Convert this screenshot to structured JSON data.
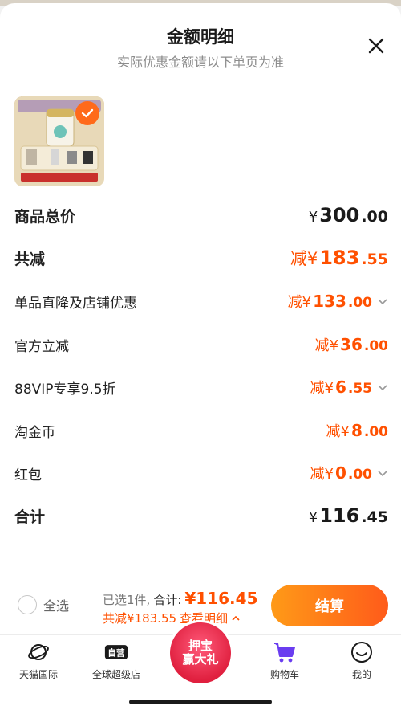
{
  "sheet": {
    "title": "金额明细",
    "subtitle": "实际优惠金额请以下单页为准"
  },
  "rows": {
    "goods_total": {
      "label": "商品总价",
      "prefix": "¥",
      "int": "300",
      "dec": ".00"
    },
    "total_reduce": {
      "label": "共减",
      "prefix": "减¥",
      "int": "183",
      "dec": ".55"
    },
    "single_discount": {
      "label": "单品直降及店铺优惠",
      "prefix": "减¥",
      "int": "133",
      "dec": ".00"
    },
    "official": {
      "label": "官方立减",
      "prefix": "减¥",
      "int": "36",
      "dec": ".00"
    },
    "vip": {
      "label": "88VIP专享9.5折",
      "prefix": "减¥",
      "int": "6",
      "dec": ".55"
    },
    "coins": {
      "label": "淘金币",
      "prefix": "减¥",
      "int": "8",
      "dec": ".00"
    },
    "red_packet": {
      "label": "红包",
      "prefix": "减¥",
      "int": "0",
      "dec": ".00"
    },
    "sum": {
      "label": "合计",
      "prefix": "¥",
      "int": "116",
      "dec": ".45"
    }
  },
  "action_bar": {
    "select_all": "全选",
    "selected": "已选1件,",
    "total_label": "合计:",
    "total_value": "¥116.45",
    "reduce_text": "共减¥183.55",
    "detail_link": "查看明细",
    "checkout": "结算"
  },
  "tabs": [
    {
      "label": "天猫国际"
    },
    {
      "label": "全球超级店",
      "icon_text": "自营"
    },
    {
      "label": "购物车"
    },
    {
      "label": "我的"
    }
  ],
  "promo": {
    "line1": "押宝",
    "line2": "赢大礼"
  },
  "colors": {
    "accent": "#ff5000",
    "cart": "#6a3df0"
  }
}
